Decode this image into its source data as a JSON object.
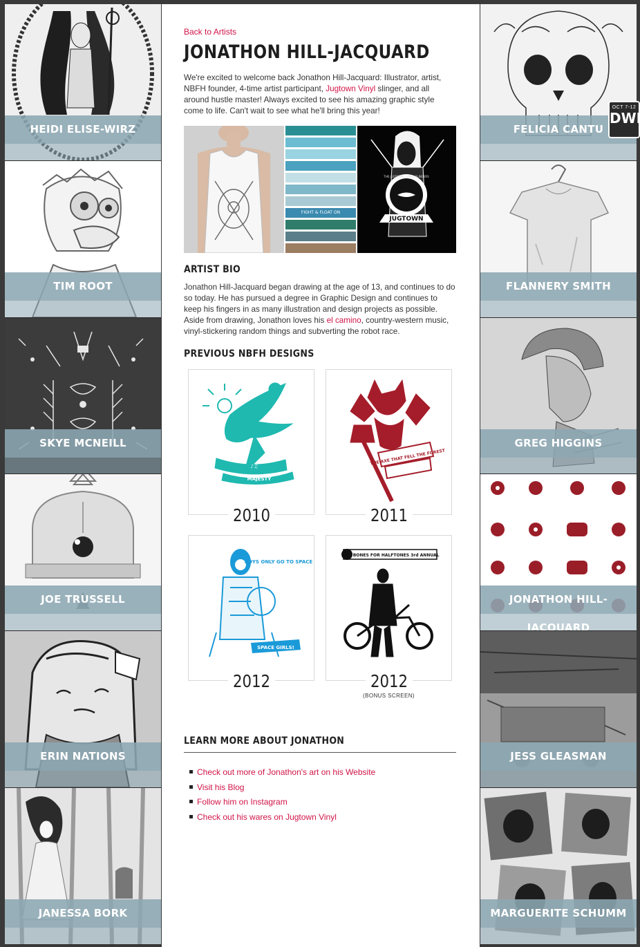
{
  "left_artists": [
    {
      "name": "HEIDI ELISE-WIRZ",
      "art": "heidi"
    },
    {
      "name": "TIM ROOT",
      "art": "tim"
    },
    {
      "name": "SKYE MCNEILL",
      "art": "skye"
    },
    {
      "name": "JOE TRUSSELL",
      "art": "joe"
    },
    {
      "name": "ERIN NATIONS",
      "art": "erin"
    },
    {
      "name": "JANESSA BORK",
      "art": "janessa"
    }
  ],
  "right_artists": [
    {
      "name": "FELICIA CANTU",
      "art": "felicia"
    },
    {
      "name": "FLANNERY SMITH",
      "art": "flannery"
    },
    {
      "name": "GREG HIGGINS",
      "art": "greg"
    },
    {
      "name": "JONATHON HILL-JACQUARD",
      "art": "jonathon"
    },
    {
      "name": "JESS GLEASMAN",
      "art": "jess"
    },
    {
      "name": "MARGUERITE SCHUMM",
      "art": "marguerite"
    }
  ],
  "badge": {
    "dates": "OCT 7-12",
    "logo": "DWP"
  },
  "page": {
    "back_link": "Back to Artists",
    "title": "JONATHON HILL-JACQUARD",
    "intro_before": "We're excited to welcome back Jonathon Hill-Jacquard: Illustrator, artist, NBFH founder, 4-time artist participant, ",
    "intro_link": "Jugtown Vinyl",
    "intro_after": " slinger, and all around hustle master! Always excited to see his amazing graphic style come to life. Can't wait to see what he'll bring this year!",
    "gallery": {
      "stripes_text": "FIGHT & FLOAT ON",
      "poster_text": "JUGTOWN",
      "poster_arc": "THE JUGTOWN · VINYL SLINGERS"
    },
    "bio_heading": "ARTIST BIO",
    "bio_before": "Jonathon Hill-Jacquard began drawing at the age of 13, and continues to do so today. He has pursued a degree in Graphic Design and continues to keep his fingers in as many illustration and design projects as possible. Aside from drawing, Jonathon loves his ",
    "bio_link": "el camino",
    "bio_after": ", country-western music, vinyl-stickering random things and subverting the robot race.",
    "prev_heading": "PREVIOUS NBFH DESIGNS",
    "designs": [
      {
        "year": "2010",
        "caption": "MAJESTY"
      },
      {
        "year": "2011",
        "caption": "THE AXE THAT FELL THE FOREST"
      },
      {
        "year": "2012",
        "caption": "BOYS ONLY GO TO SPACE",
        "caption2": "SPACE GIRLS!"
      },
      {
        "year": "2012",
        "note": "(BONUS SCREEN)",
        "caption": "NO BONES FOR HALFTONES 3rd ANNUAL"
      }
    ],
    "learn_heading": "LEARN MORE ABOUT JONATHON",
    "links": [
      "Check out more of Jonathon's art on his Website",
      "Visit his Blog",
      "Follow him on Instagram",
      "Check out his wares on Jugtown Vinyl"
    ]
  }
}
